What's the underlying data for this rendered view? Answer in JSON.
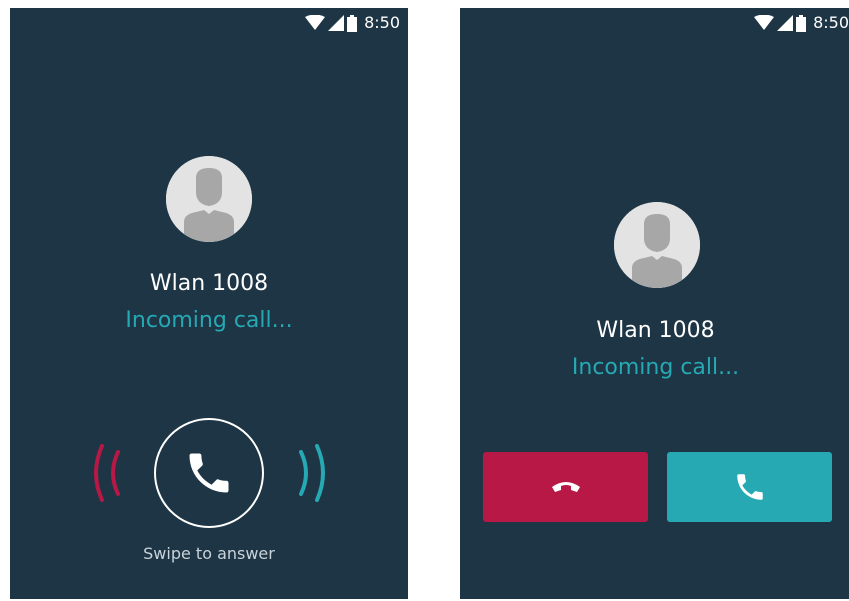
{
  "colors": {
    "background": "#1d3545",
    "accent_teal": "#26a9b3",
    "decline_red": "#b71845",
    "text": "#ffffff",
    "avatar_bg": "#e3e3e3",
    "avatar_silhouette": "#a7a7a7"
  },
  "screens": [
    {
      "status_bar": {
        "time": "8:50",
        "icons": [
          "wifi-icon",
          "cell-signal-icon",
          "battery-icon"
        ]
      },
      "caller": {
        "name": "Wlan 1008",
        "status": "Incoming call..."
      },
      "answer": {
        "icon": "phone-icon",
        "hint": "Swipe to answer"
      }
    },
    {
      "status_bar": {
        "time": "8:50",
        "icons": [
          "wifi-icon",
          "cell-signal-icon",
          "battery-icon"
        ]
      },
      "caller": {
        "name": "Wlan 1008",
        "status": "Incoming call..."
      },
      "buttons": [
        {
          "action": "decline",
          "icon": "hang-up-icon"
        },
        {
          "action": "answer",
          "icon": "phone-icon"
        }
      ]
    }
  ]
}
